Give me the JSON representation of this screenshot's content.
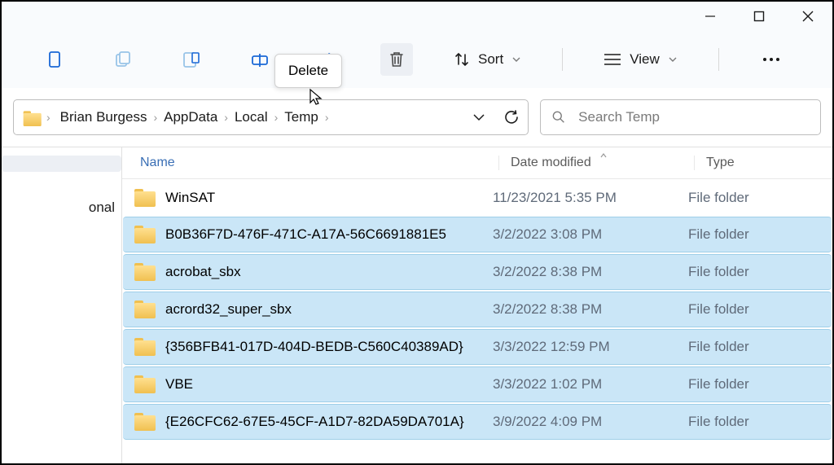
{
  "titlebar": {
    "minimize": "—",
    "maximize": "▢",
    "close": "✕"
  },
  "toolbar": {
    "sort_label": "Sort",
    "view_label": "View",
    "tooltip": "Delete"
  },
  "breadcrumb": [
    "Brian Burgess",
    "AppData",
    "Local",
    "Temp"
  ],
  "search": {
    "placeholder": "Search Temp"
  },
  "sidebar": {
    "items": [
      "",
      "onal"
    ]
  },
  "columns": {
    "name": "Name",
    "date": "Date modified",
    "type": "Type"
  },
  "rows": [
    {
      "name": "WinSAT",
      "date": "11/23/2021 5:35 PM",
      "type": "File folder",
      "selected": false
    },
    {
      "name": "B0B36F7D-476F-471C-A17A-56C6691881E5",
      "date": "3/2/2022 3:08 PM",
      "type": "File folder",
      "selected": true
    },
    {
      "name": "acrobat_sbx",
      "date": "3/2/2022 8:38 PM",
      "type": "File folder",
      "selected": true
    },
    {
      "name": "acrord32_super_sbx",
      "date": "3/2/2022 8:38 PM",
      "type": "File folder",
      "selected": true
    },
    {
      "name": "{356BFB41-017D-404D-BEDB-C560C40389AD}",
      "date": "3/3/2022 12:59 PM",
      "type": "File folder",
      "selected": true
    },
    {
      "name": "VBE",
      "date": "3/3/2022 1:02 PM",
      "type": "File folder",
      "selected": true
    },
    {
      "name": "{E26CFC62-67E5-45CF-A1D7-82DA59DA701A}",
      "date": "3/9/2022 4:09 PM",
      "type": "File folder",
      "selected": true
    }
  ]
}
